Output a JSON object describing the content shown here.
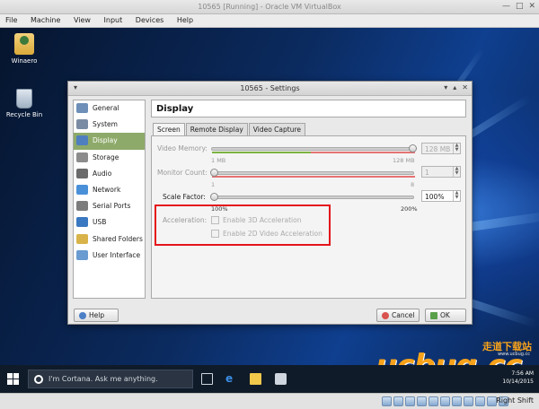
{
  "vm_window": {
    "title": "10565 [Running] - Oracle VM VirtualBox",
    "menu": [
      "File",
      "Machine",
      "View",
      "Input",
      "Devices",
      "Help"
    ],
    "host_key": "Right Shift"
  },
  "desktop": {
    "icons": [
      {
        "label": "Winaero",
        "icon": "user-folder-icon"
      },
      {
        "label": "Recycle Bin",
        "icon": "recycle-bin-icon"
      }
    ]
  },
  "taskbar": {
    "cortana_placeholder": "I'm Cortana. Ask me anything.",
    "clock_time": "7:56 AM",
    "clock_date": "10/14/2015"
  },
  "watermark": {
    "brand": "ucbug.cc",
    "chinese": "走道下载站",
    "small": "www.ucbug.cc"
  },
  "dialog": {
    "title": "10565 - Settings",
    "page_title": "Display",
    "nav": [
      {
        "label": "General",
        "icon": "general-icon",
        "selected": false
      },
      {
        "label": "System",
        "icon": "system-icon",
        "selected": false
      },
      {
        "label": "Display",
        "icon": "display-icon",
        "selected": true
      },
      {
        "label": "Storage",
        "icon": "storage-icon",
        "selected": false
      },
      {
        "label": "Audio",
        "icon": "audio-icon",
        "selected": false
      },
      {
        "label": "Network",
        "icon": "network-icon",
        "selected": false
      },
      {
        "label": "Serial Ports",
        "icon": "serial-ports-icon",
        "selected": false
      },
      {
        "label": "USB",
        "icon": "usb-icon",
        "selected": false
      },
      {
        "label": "Shared Folders",
        "icon": "shared-folders-icon",
        "selected": false
      },
      {
        "label": "User Interface",
        "icon": "user-interface-icon",
        "selected": false
      }
    ],
    "tabs": [
      "Screen",
      "Remote Display",
      "Video Capture"
    ],
    "active_tab": "Screen",
    "video_memory": {
      "label": "Video Memory:",
      "value": "128 MB",
      "min": "1 MB",
      "max": "128 MB",
      "level": 1.0
    },
    "monitor_count": {
      "label": "Monitor Count:",
      "value": "1",
      "min": "1",
      "max": "8",
      "level": 0.0
    },
    "scale_factor": {
      "label": "Scale Factor:",
      "value": "100%",
      "min": "100%",
      "max": "200%",
      "level": 0.0
    },
    "acceleration": {
      "label": "Acceleration:",
      "enable_3d": "Enable 3D Acceleration",
      "enable_2d": "Enable 2D Video Acceleration"
    },
    "buttons": {
      "help": "Help",
      "cancel": "Cancel",
      "ok": "OK"
    }
  }
}
